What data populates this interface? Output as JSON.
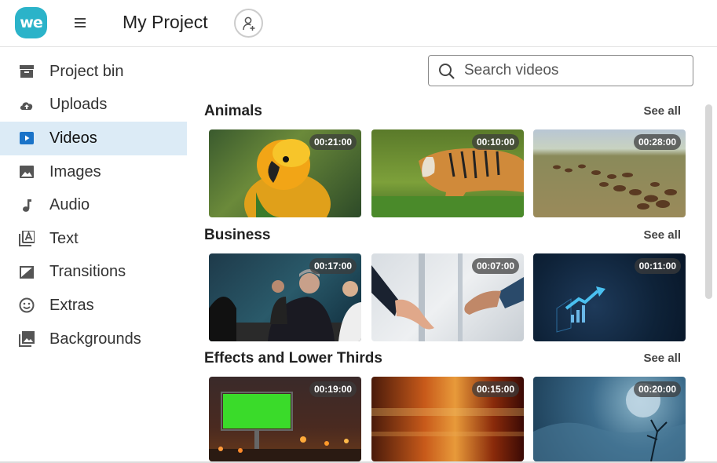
{
  "app": {
    "logo_text": "we",
    "title": "My Project"
  },
  "sidebar": {
    "items": [
      {
        "label": "Project bin",
        "icon": "archive-icon"
      },
      {
        "label": "Uploads",
        "icon": "cloud-upload-icon"
      },
      {
        "label": "Videos",
        "icon": "video-play-icon",
        "active": true
      },
      {
        "label": "Images",
        "icon": "image-icon"
      },
      {
        "label": "Audio",
        "icon": "music-note-icon"
      },
      {
        "label": "Text",
        "icon": "text-icon"
      },
      {
        "label": "Transitions",
        "icon": "transition-icon"
      },
      {
        "label": "Extras",
        "icon": "smiley-icon"
      },
      {
        "label": "Backgrounds",
        "icon": "backgrounds-icon"
      }
    ]
  },
  "search": {
    "placeholder": "Search videos"
  },
  "sections": [
    {
      "title": "Animals",
      "see_all": "See all",
      "videos": [
        {
          "duration": "00:21:00"
        },
        {
          "duration": "00:10:00"
        },
        {
          "duration": "00:28:00"
        }
      ]
    },
    {
      "title": "Business",
      "see_all": "See all",
      "videos": [
        {
          "duration": "00:17:00"
        },
        {
          "duration": "00:07:00"
        },
        {
          "duration": "00:11:00"
        }
      ]
    },
    {
      "title": "Effects and Lower Thirds",
      "see_all": "See all",
      "videos": [
        {
          "duration": "00:19:00"
        },
        {
          "duration": "00:15:00"
        },
        {
          "duration": "00:20:00"
        }
      ]
    }
  ],
  "colors": {
    "accent": "#2bb3c9",
    "active_bg": "#dcebf6",
    "active_icon": "#1a73c8"
  }
}
